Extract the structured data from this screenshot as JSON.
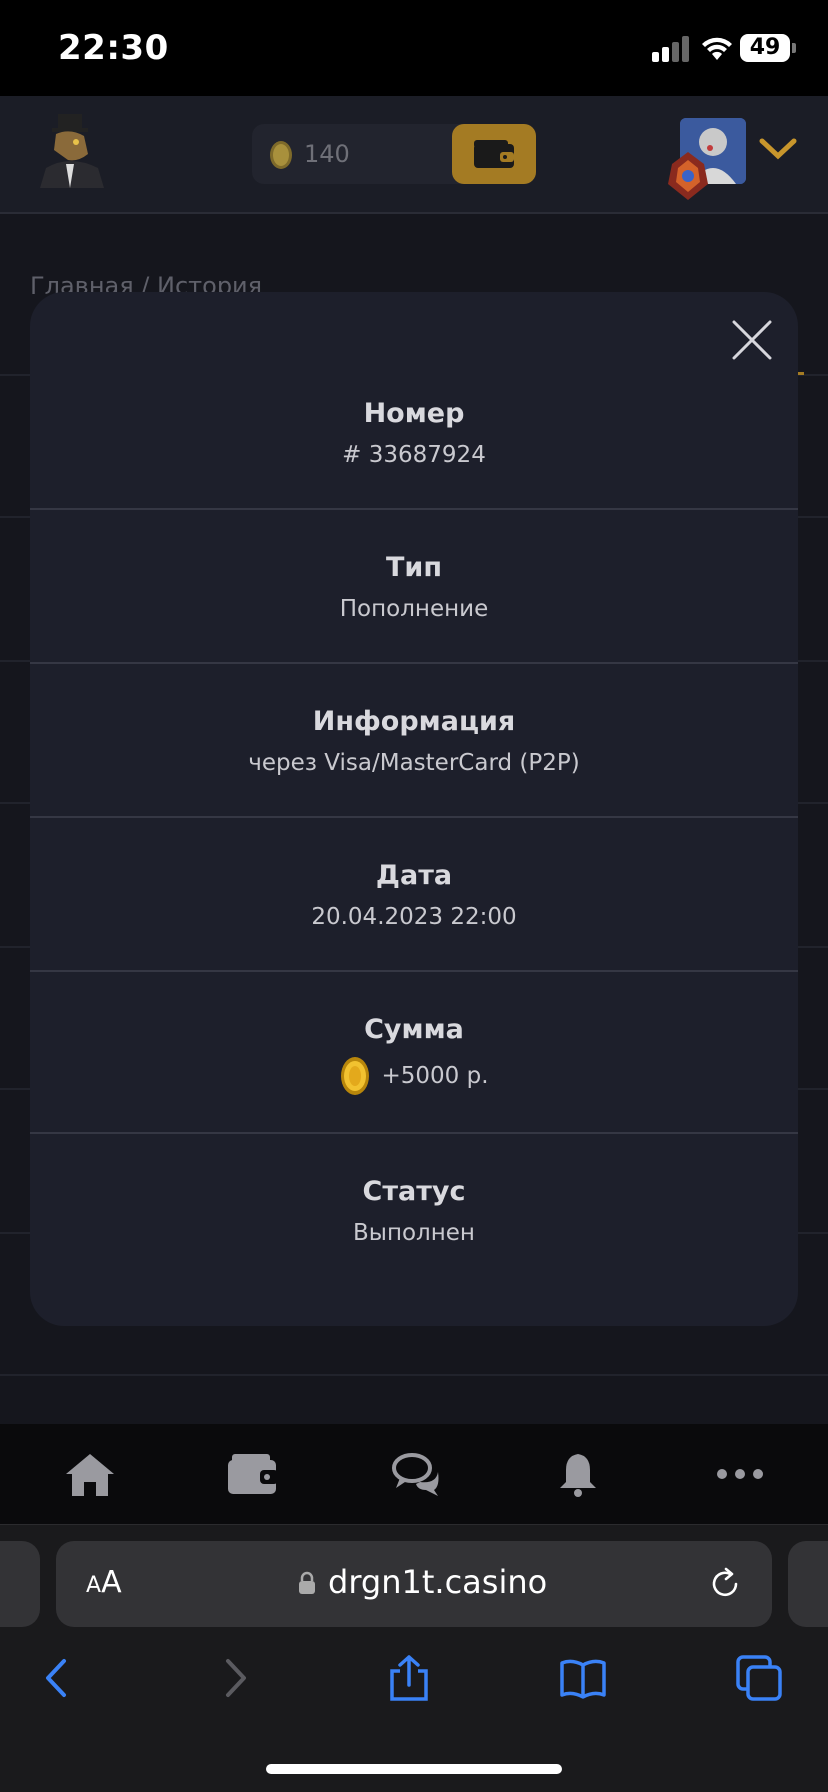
{
  "status_bar": {
    "time": "22:30",
    "battery": "49"
  },
  "header": {
    "balance": "140",
    "icons": [
      "logo-icon",
      "coin-icon",
      "wallet-icon",
      "avatar",
      "rank-badge-icon",
      "chevron-down-icon"
    ]
  },
  "breadcrumb": "Главная / История",
  "modal": {
    "rows": [
      {
        "label": "Номер",
        "value": "# 33687924"
      },
      {
        "label": "Тип",
        "value": "Пополнение"
      },
      {
        "label": "Информация",
        "value": "через Visa/MasterCard (P2P)"
      },
      {
        "label": "Дата",
        "value": "20.04.2023 22:00"
      },
      {
        "label": "Сумма",
        "value": "+5000 р."
      },
      {
        "label": "Статус",
        "value": "Выполнен"
      }
    ],
    "close_icon": "close-icon"
  },
  "bottom_nav": [
    "home-icon",
    "wallet-icon",
    "chat-icon",
    "bell-icon",
    "more-icon"
  ],
  "browser": {
    "aa_label": "AA",
    "url": "drgn1t.casino",
    "toolbar": [
      "back-icon",
      "forward-icon",
      "share-icon",
      "bookmarks-icon",
      "tabs-icon"
    ]
  },
  "colors": {
    "accent": "#a47b23",
    "modal_bg": "#1d1f2b",
    "link_blue": "#3a82f7"
  }
}
